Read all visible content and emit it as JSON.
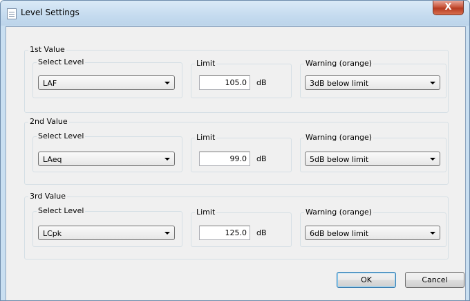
{
  "window": {
    "title": "Level Settings",
    "close_glyph": "X"
  },
  "groups": [
    {
      "title": "1st Value",
      "level_label": "Select Level",
      "level_value": "LAF",
      "limit_label": "Limit",
      "limit_value": "105.0",
      "unit": "dB",
      "warning_label": "Warning (orange)",
      "warning_value": "3dB below limit"
    },
    {
      "title": "2nd Value",
      "level_label": "Select Level",
      "level_value": "LAeq",
      "limit_label": "Limit",
      "limit_value": "99.0",
      "unit": "dB",
      "warning_label": "Warning (orange)",
      "warning_value": "5dB below limit"
    },
    {
      "title": "3rd Value",
      "level_label": "Select Level",
      "level_value": "LCpk",
      "limit_label": "Limit",
      "limit_value": "125.0",
      "unit": "dB",
      "warning_label": "Warning (orange)",
      "warning_value": "6dB below limit"
    }
  ],
  "buttons": {
    "ok": "OK",
    "cancel": "Cancel"
  },
  "icons": {
    "title_icon": "document-icon",
    "close_icon": "close-icon",
    "dropdown_icon": "chevron-down-icon"
  }
}
